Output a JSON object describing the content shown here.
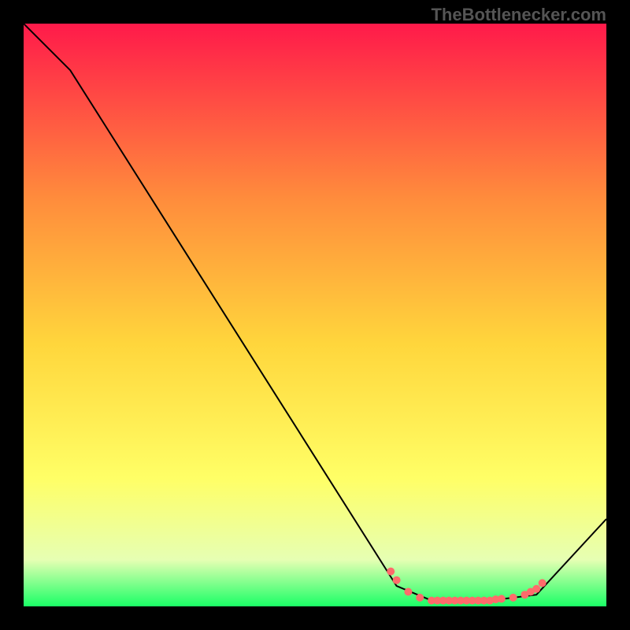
{
  "watermark": "TheBottlenecker.com",
  "chart_data": {
    "type": "line",
    "title": "",
    "xlabel": "",
    "ylabel": "",
    "xlim": [
      0,
      100
    ],
    "ylim": [
      0,
      100
    ],
    "background_gradient": {
      "top_color": "#ff1a4a",
      "mid_top_color": "#ff8c3c",
      "mid_color": "#ffd63c",
      "mid_low_color": "#ffff66",
      "low_color": "#e6ffb3",
      "bottom_color": "#1aff66"
    },
    "series": [
      {
        "name": "bottleneck-curve",
        "color": "#000000",
        "stroke_width": 2,
        "points": [
          {
            "x": 0,
            "y": 100
          },
          {
            "x": 8,
            "y": 92
          },
          {
            "x": 64,
            "y": 3.5
          },
          {
            "x": 70,
            "y": 1
          },
          {
            "x": 80,
            "y": 1
          },
          {
            "x": 88,
            "y": 2
          },
          {
            "x": 100,
            "y": 15
          }
        ]
      }
    ],
    "markers": {
      "name": "highlight-dots",
      "color": "#ff6b6b",
      "radius": 5,
      "points": [
        {
          "x": 63,
          "y": 6
        },
        {
          "x": 64,
          "y": 4.5
        },
        {
          "x": 66,
          "y": 2.5
        },
        {
          "x": 68,
          "y": 1.5
        },
        {
          "x": 70,
          "y": 1
        },
        {
          "x": 71,
          "y": 1
        },
        {
          "x": 72,
          "y": 1
        },
        {
          "x": 73,
          "y": 1
        },
        {
          "x": 74,
          "y": 1
        },
        {
          "x": 75,
          "y": 1
        },
        {
          "x": 76,
          "y": 1
        },
        {
          "x": 77,
          "y": 1
        },
        {
          "x": 78,
          "y": 1
        },
        {
          "x": 79,
          "y": 1
        },
        {
          "x": 80,
          "y": 1
        },
        {
          "x": 81,
          "y": 1.2
        },
        {
          "x": 82,
          "y": 1.3
        },
        {
          "x": 84,
          "y": 1.5
        },
        {
          "x": 86,
          "y": 2
        },
        {
          "x": 87,
          "y": 2.5
        },
        {
          "x": 88,
          "y": 3
        },
        {
          "x": 89,
          "y": 4
        }
      ]
    }
  }
}
